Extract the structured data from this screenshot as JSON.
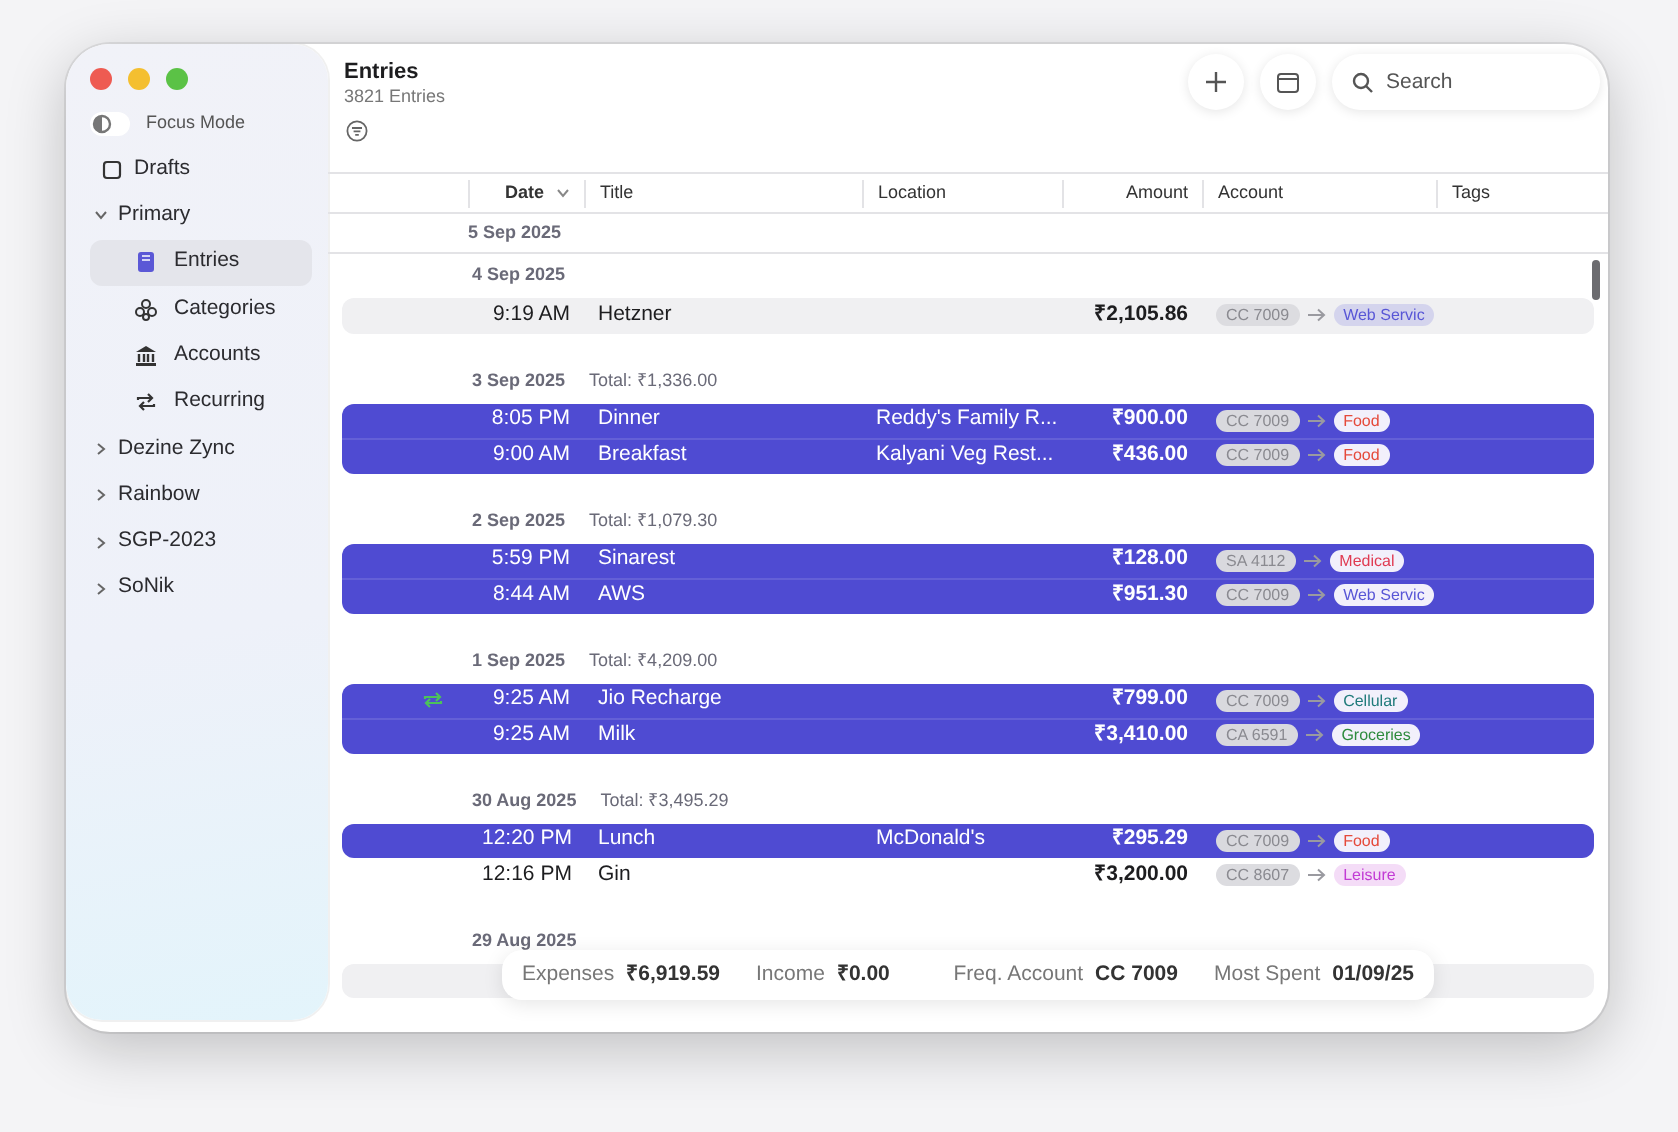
{
  "window": {
    "title": "Entries",
    "subtitle": "3821 Entries"
  },
  "sidebar": {
    "focus_mode": {
      "label": "Focus Mode",
      "on": false
    },
    "items": [
      {
        "label": "Drafts",
        "kind": "page",
        "selected": false
      },
      {
        "label": "Primary",
        "kind": "folder",
        "expanded": true,
        "selected": false,
        "children": [
          {
            "label": "Entries",
            "selected": true
          },
          {
            "label": "Categories",
            "selected": false
          },
          {
            "label": "Accounts",
            "selected": false
          },
          {
            "label": "Recurring",
            "selected": false
          }
        ]
      },
      {
        "label": "Dezine Zync",
        "kind": "folder",
        "expanded": false,
        "selected": false
      },
      {
        "label": "Rainbow",
        "kind": "folder",
        "expanded": false,
        "selected": false
      },
      {
        "label": "SGP-2023",
        "kind": "folder",
        "expanded": false,
        "selected": false
      },
      {
        "label": "SoNik",
        "kind": "folder",
        "expanded": false,
        "selected": false
      }
    ]
  },
  "toolbar": {
    "search": {
      "placeholder": "Search"
    }
  },
  "table": {
    "columns": [
      {
        "label": "Date",
        "sorted": true
      },
      {
        "label": "Title",
        "sorted": false
      },
      {
        "label": "Location",
        "sorted": false
      },
      {
        "label": "Amount",
        "sorted": false
      },
      {
        "label": "Account",
        "sorted": false
      },
      {
        "label": "Tags",
        "sorted": false
      }
    ],
    "pinned_date": "5 Sep 2025",
    "groups": [
      {
        "date": "4 Sep 2025",
        "rows": [
          {
            "time": "9:19 AM",
            "title": "Hetzner",
            "amount": "₹2,105.86",
            "account": "CC 7009",
            "category": "Web Servic",
            "color": "#5856d6",
            "selected": false,
            "hovered": true,
            "recurring": false
          }
        ]
      },
      {
        "date": "3 Sep 2025",
        "total": "Total: ₹1,336.00",
        "rows": [
          {
            "time": "8:05 PM",
            "title": "Dinner",
            "location": "Reddy's Family R...",
            "amount": "₹900.00",
            "account": "CC 7009",
            "category": "Food",
            "color": "#e5493a",
            "selected": true,
            "recurring": false
          },
          {
            "time": "9:00 AM",
            "title": "Breakfast",
            "location": "Kalyani Veg Rest...",
            "amount": "₹436.00",
            "account": "CC 7009",
            "category": "Food",
            "color": "#e5493a",
            "selected": true,
            "recurring": false
          }
        ]
      },
      {
        "date": "2 Sep 2025",
        "total": "Total: ₹1,079.30",
        "rows": [
          {
            "time": "5:59 PM",
            "title": "Sinarest",
            "amount": "₹128.00",
            "account": "SA 4112",
            "category": "Medical",
            "color": "#e03a52",
            "selected": true,
            "recurring": false
          },
          {
            "time": "8:44 AM",
            "title": "AWS",
            "amount": "₹951.30",
            "account": "CC 7009",
            "category": "Web Servic",
            "color": "#5856d6",
            "selected": true,
            "recurring": false
          }
        ]
      },
      {
        "date": "1 Sep 2025",
        "total": "Total: ₹4,209.00",
        "rows": [
          {
            "time": "9:25 AM",
            "title": "Jio Recharge",
            "amount": "₹799.00",
            "account": "CC 7009",
            "category": "Cellular",
            "color": "#1f7a7a",
            "selected": true,
            "recurring": true
          },
          {
            "time": "9:25 AM",
            "title": "Milk",
            "amount": "₹3,410.00",
            "account": "CA 6591",
            "category": "Groceries",
            "color": "#2e8b3e",
            "selected": true,
            "recurring": false
          }
        ]
      },
      {
        "date": "30 Aug 2025",
        "total": "Total: ₹3,495.29",
        "rows": [
          {
            "time": "12:20 PM",
            "title": "Lunch",
            "location": "McDonald's",
            "amount": "₹295.29",
            "account": "CC 7009",
            "category": "Food",
            "color": "#e5493a",
            "selected": true,
            "recurring": false
          },
          {
            "time": "12:16 PM",
            "title": "Gin",
            "amount": "₹3,200.00",
            "account": "CC 8607",
            "category": "Leisure",
            "color": "#c23bd4",
            "selected": false,
            "hovered": false,
            "recurring": false
          }
        ]
      },
      {
        "date": "29 Aug 2025",
        "rows": [
          {
            "selected": false,
            "hovered": true,
            "recurring": false
          }
        ]
      }
    ]
  },
  "summary": [
    {
      "label": "Expenses",
      "value": "₹6,919.59"
    },
    {
      "label": "Income",
      "value": "₹0.00"
    },
    {
      "label": "Freq. Account",
      "value": "CC 7009"
    },
    {
      "label": "Most Spent",
      "value": "01/09/25"
    }
  ]
}
